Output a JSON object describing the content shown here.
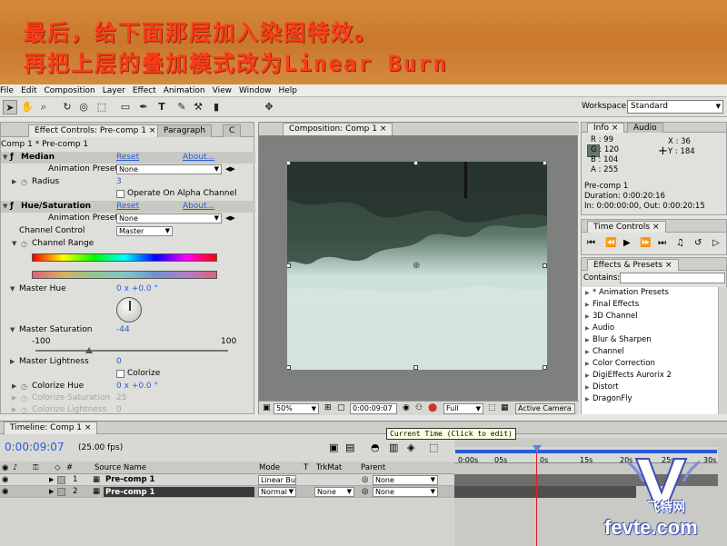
{
  "banner": {
    "line1": "最后，给下面那层加入染图特效。",
    "line2": "再把上层的叠加模式改为Linear Burn"
  },
  "menu": [
    "File",
    "Edit",
    "Composition",
    "Layer",
    "Effect",
    "Animation",
    "View",
    "Window",
    "Help"
  ],
  "toolbar": {
    "workspace_label": "Workspace:",
    "workspace_value": "Standard"
  },
  "effect_controls": {
    "tab_label": "Effect Controls: Pre-comp 1",
    "tab2_label": "Paragraph",
    "tab3_label": "C",
    "breadcrumb": "Comp 1 * Pre-comp 1",
    "median": {
      "name": "Median",
      "reset": "Reset",
      "about": "About...",
      "presets_label": "Animation Presets:",
      "presets_value": "None",
      "radius_label": "Radius",
      "radius_value": "3",
      "alpha_label": "Operate On Alpha Channel"
    },
    "hue_sat": {
      "name": "Hue/Saturation",
      "reset": "Reset",
      "about": "About...",
      "presets_label": "Animation Presets:",
      "presets_value": "None",
      "channel_control_label": "Channel Control",
      "channel_control_value": "Master",
      "channel_range_label": "Channel Range",
      "master_hue_label": "Master Hue",
      "master_hue_value": "0 x +0.0 °",
      "master_sat_label": "Master Saturation",
      "master_sat_value": "-44",
      "master_sat_min": "-100",
      "master_sat_max": "100",
      "master_sat_level": -44,
      "master_light_label": "Master Lightness",
      "master_light_value": "0",
      "colorize_label": "Colorize",
      "colorize_hue_label": "Colorize Hue",
      "colorize_hue_value": "0 x +0.0 °",
      "colorize_sat_label": "Colorize Saturation",
      "colorize_sat_value": "25",
      "colorize_light_label": "Colorize Lightness",
      "colorize_light_value": "0"
    }
  },
  "composition": {
    "tab_label": "Composition: Comp 1",
    "zoom": "50%",
    "timecode": "0:00:09:07",
    "resolution": "Full",
    "camera": "Active Camera"
  },
  "info": {
    "tab_label": "Info",
    "tab2_label": "Audio",
    "r": "R : 99",
    "g": "G : 120",
    "b": "B : 104",
    "a": "A : 255",
    "x": "X : 36",
    "y": "Y : 184",
    "layer_name": "Pre-comp 1",
    "duration": "Duration: 0:00:20:16",
    "in_out": "In: 0:00:00:00, Out: 0:00:20:15",
    "swatch_color": "#637868"
  },
  "time_controls": {
    "tab_label": "Time Controls"
  },
  "effects_presets": {
    "tab_label": "Effects & Presets",
    "contains_label": "Contains:",
    "items": [
      "* Animation Presets",
      "Final Effects",
      "3D Channel",
      "Audio",
      "Blur & Sharpen",
      "Channel",
      "Color Correction",
      "DigiEffects Aurorix 2",
      "Distort",
      "DragonFly"
    ]
  },
  "timeline": {
    "tab_label": "Timeline: Comp 1",
    "current_time": "0:00:09:07",
    "fps": "(25.00 fps)",
    "tooltip": "Current Time (Click to edit)",
    "col_source": "Source Name",
    "col_mode": "Mode",
    "col_t": "T",
    "col_trkmat": "TrkMat",
    "col_parent": "Parent",
    "ruler": [
      "0:00s",
      "05s",
      "0s",
      "15s",
      "20s",
      "25s",
      "30s"
    ],
    "layers": [
      {
        "num": "1",
        "name": "Pre-comp 1",
        "mode": "Linear Bu",
        "trkmat": "",
        "parent": "None"
      },
      {
        "num": "2",
        "name": "Pre-comp 1",
        "mode": "Normal",
        "trkmat": "None",
        "parent": "None"
      }
    ]
  },
  "watermark": {
    "cn": "飞特网",
    "site": "fevte.com"
  }
}
